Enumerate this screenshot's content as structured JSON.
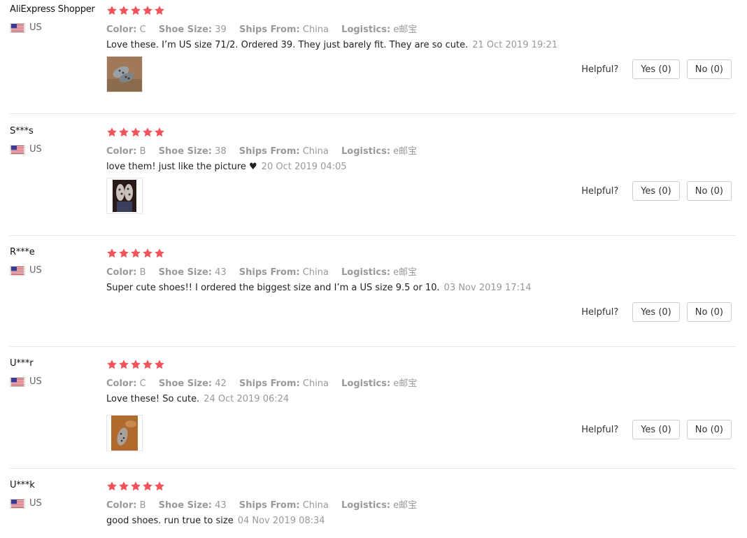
{
  "labels": {
    "color": "Color:",
    "shoe_size": "Shoe Size:",
    "ships_from": "Ships From:",
    "logistics": "Logistics:",
    "helpful": "Helpful?"
  },
  "star_color": "#f0535a",
  "reviews": [
    {
      "user": "AliExpress Shopper",
      "country": "US",
      "rating": 5,
      "color": "C",
      "shoe_size": "39",
      "ships_from": "China",
      "logistics": "e邮宝",
      "comment": "Love these. I’m US size 71/2. Ordered 39. They just barely fit. They are so cute.",
      "date": "21 Oct 2019 19:21",
      "has_photo": true,
      "yes": "Yes (0)",
      "no": "No (0)"
    },
    {
      "user": "S***s",
      "country": "US",
      "rating": 5,
      "color": "B",
      "shoe_size": "38",
      "ships_from": "China",
      "logistics": "e邮宝",
      "comment": "love them! just like the picture ♥",
      "date": "20 Oct 2019 04:05",
      "has_photo": true,
      "yes": "Yes (0)",
      "no": "No (0)"
    },
    {
      "user": "R***e",
      "country": "US",
      "rating": 5,
      "color": "B",
      "shoe_size": "43",
      "ships_from": "China",
      "logistics": "e邮宝",
      "comment": "Super cute shoes!! I ordered the biggest size and I’m a US size 9.5 or 10.",
      "date": "03 Nov 2019 17:14",
      "has_photo": false,
      "yes": "Yes (0)",
      "no": "No (0)"
    },
    {
      "user": "U***r",
      "country": "US",
      "rating": 5,
      "color": "C",
      "shoe_size": "42",
      "ships_from": "China",
      "logistics": "e邮宝",
      "comment": "Love these! So cute.",
      "date": "24 Oct 2019 06:24",
      "has_photo": true,
      "yes": "Yes (0)",
      "no": "No (0)"
    },
    {
      "user": "U***k",
      "country": "US",
      "rating": 5,
      "color": "B",
      "shoe_size": "43",
      "ships_from": "China",
      "logistics": "e邮宝",
      "comment": "good shoes. run true to size",
      "date": "04 Nov 2019 08:34",
      "has_photo": false,
      "yes": "",
      "no": ""
    }
  ]
}
